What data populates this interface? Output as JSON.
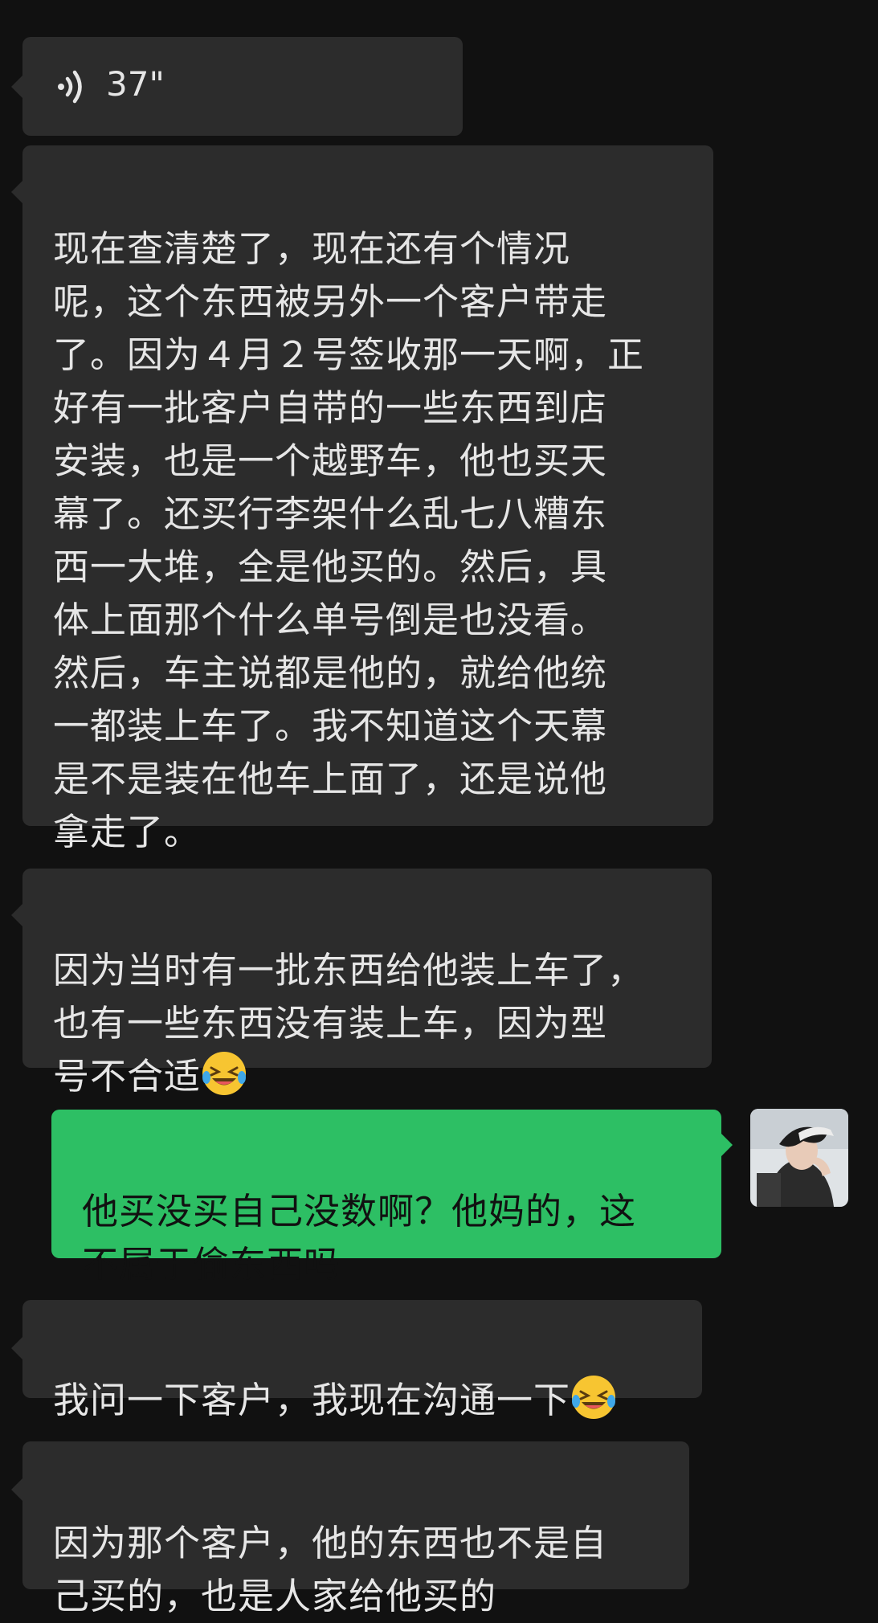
{
  "voice": {
    "duration": "37\"",
    "icon": "voice-wave-icon"
  },
  "messages": [
    {
      "text": "现在查清楚了，现在还有个情况\n呢，这个东西被另外一个客户带走\n了。因为４月２号签收那一天啊，正\n好有一批客户自带的一些东西到店\n安装，也是一个越野车，他也买天\n幕了。还买行李架什么乱七八糟东\n西一大堆，全是他买的。然后，具\n体上面那个什么单号倒是也没看。\n然后，车主说都是他的，就给他统\n一都装上车了。我不知道这个天幕\n是不是装在他车上面了，还是说他\n拿走了。"
    },
    {
      "text": "因为当时有一批东西给他装上车了，\n也有一些东西没有装上车，因为型\n号不合适",
      "emoji": "grinning-squinting-tears-emoji"
    },
    {
      "text": "他买没买自己没数啊？他妈的，这\n不属于偷东西吗"
    },
    {
      "text": "我问一下客户，我现在沟通一下",
      "emoji": "grinning-squinting-tears-emoji"
    },
    {
      "text": "因为那个客户，他的东西也不是自\n己买的，也是人家给他买的"
    }
  ],
  "colors": {
    "background": "#111111",
    "incoming_bubble": "#2c2c2c",
    "outgoing_bubble": "#2dbf64",
    "incoming_text": "#e6e6e6",
    "outgoing_text": "#111111"
  }
}
